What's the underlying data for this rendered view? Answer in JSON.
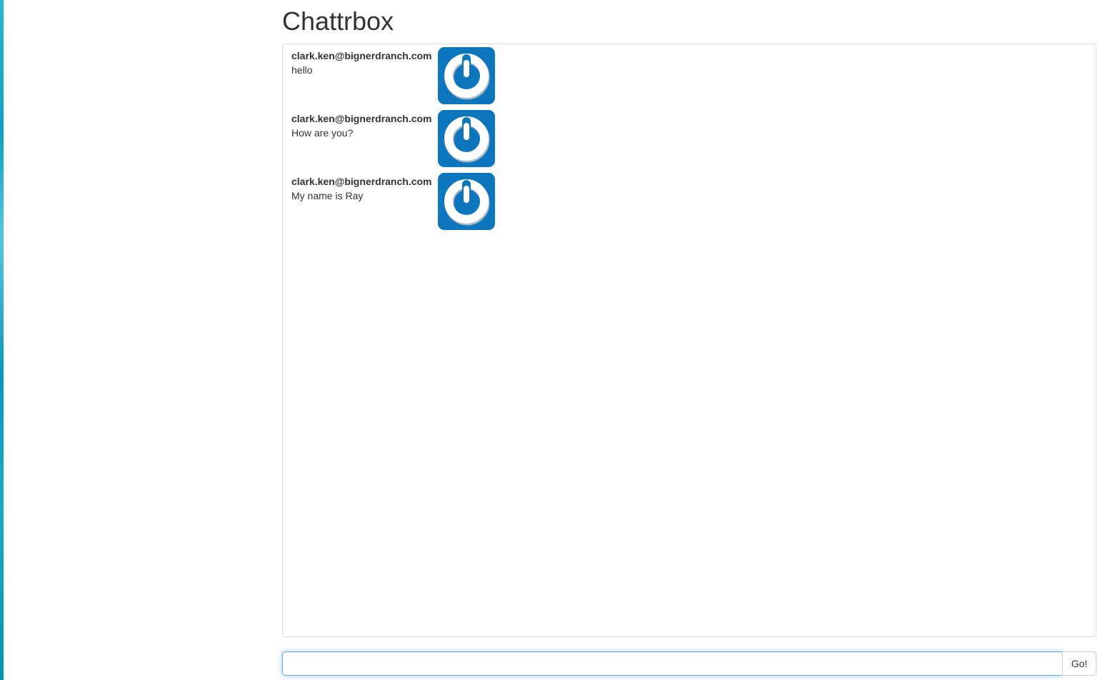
{
  "app": {
    "title": "Chattrbox"
  },
  "messages": [
    {
      "sender": "clark.ken@bignerdranch.com",
      "text": "hello",
      "avatar_icon": "power-avatar-icon"
    },
    {
      "sender": "clark.ken@bignerdranch.com",
      "text": "How are you?",
      "avatar_icon": "power-avatar-icon"
    },
    {
      "sender": "clark.ken@bignerdranch.com",
      "text": "My name is Ray",
      "avatar_icon": "power-avatar-icon"
    }
  ],
  "composer": {
    "input_value": "",
    "placeholder": "",
    "send_label": "Go!"
  },
  "colors": {
    "avatar_blue": "#0d76bc",
    "focus_border": "#66afe9",
    "panel_border": "#dddddd",
    "edge_accent": "#1aa8cc"
  }
}
